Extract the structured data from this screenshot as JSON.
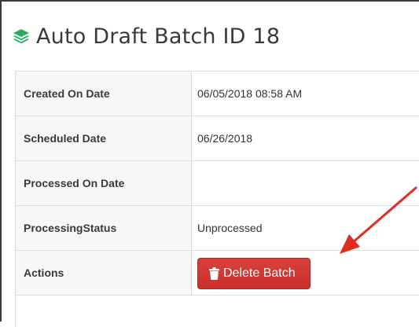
{
  "header": {
    "icon": "layers-icon",
    "icon_color": "#27ae60",
    "title": "Auto Draft Batch ID 18"
  },
  "details": {
    "rows": [
      {
        "label": "Created On Date",
        "value": "06/05/2018 08:58 AM"
      },
      {
        "label": "Scheduled Date",
        "value": "06/26/2018"
      },
      {
        "label": "Processed On Date",
        "value": ""
      },
      {
        "label": "ProcessingStatus",
        "value": "Unprocessed"
      },
      {
        "label": "Actions",
        "value": ""
      }
    ]
  },
  "actions": {
    "delete_label": "Delete Batch",
    "delete_icon": "trash-icon",
    "delete_color": "#d43f3a"
  },
  "annotation": {
    "type": "arrow",
    "color": "#e32b22"
  }
}
